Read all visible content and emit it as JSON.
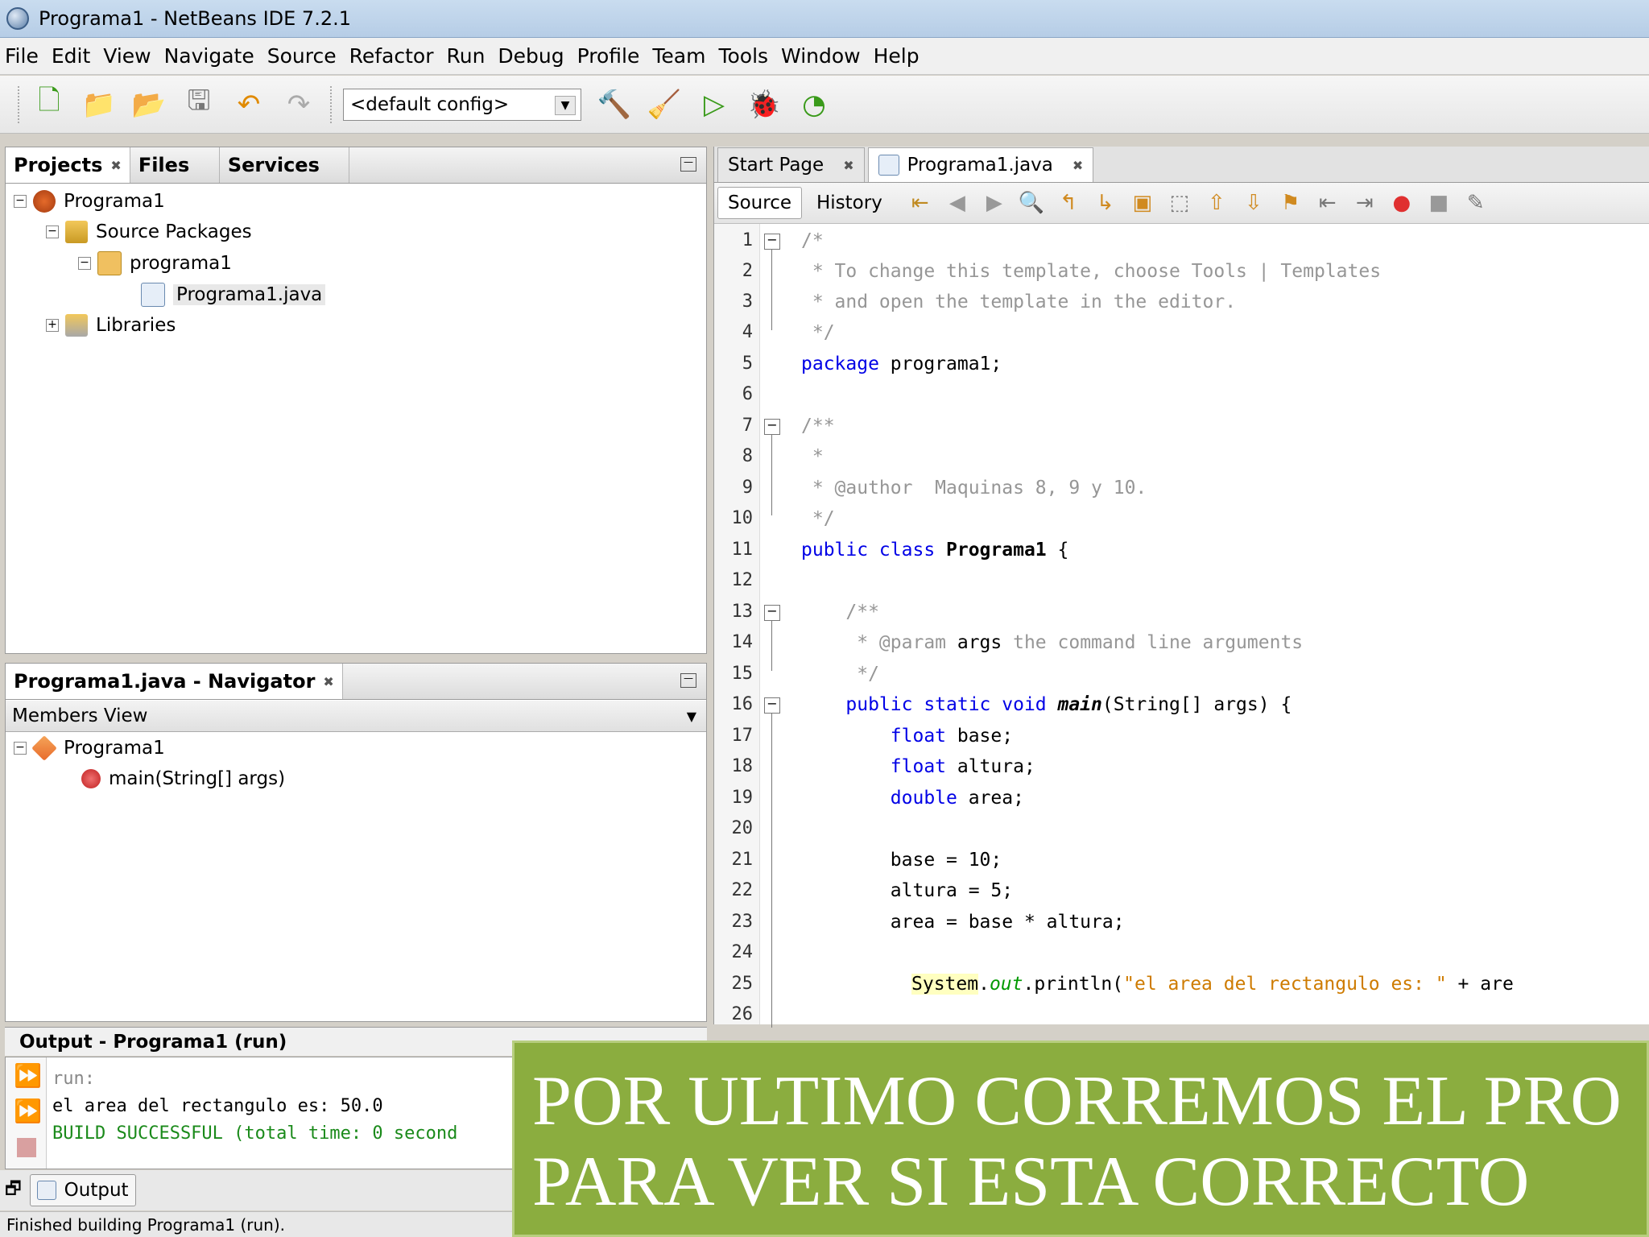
{
  "window": {
    "title": "Programa1 - NetBeans IDE 7.2.1"
  },
  "menu": [
    "File",
    "Edit",
    "View",
    "Navigate",
    "Source",
    "Refactor",
    "Run",
    "Debug",
    "Profile",
    "Team",
    "Tools",
    "Window",
    "Help"
  ],
  "toolbar": {
    "config_value": "<default config>"
  },
  "projects_panel": {
    "tabs": [
      "Projects",
      "Files",
      "Services"
    ],
    "tree": {
      "project": "Programa1",
      "source_packages": "Source Packages",
      "package": "programa1",
      "file": "Programa1.java",
      "libraries": "Libraries"
    }
  },
  "navigator": {
    "title": "Programa1.java - Navigator",
    "view": "Members View",
    "class": "Programa1",
    "member": "main(String[] args)"
  },
  "editor": {
    "tabs": [
      "Start Page",
      "Programa1.java"
    ],
    "modes": [
      "Source",
      "History"
    ],
    "line_numbers": [
      "1",
      "2",
      "3",
      "4",
      "5",
      "6",
      "7",
      "8",
      "9",
      "10",
      "11",
      "12",
      "13",
      "14",
      "15",
      "16",
      "17",
      "18",
      "19",
      "20",
      "21",
      "22",
      "23",
      "24",
      "25",
      "26"
    ],
    "code": {
      "l1": "/*",
      "l2": " * To change this template, choose Tools | Templates",
      "l3": " * and open the template in the editor.",
      "l4": " */",
      "l5_kw": "package",
      "l5_rest": " programa1;",
      "l7": "/**",
      "l8": " *",
      "l9": " * @author  Maquinas 8, 9 y 10.",
      "l10": " */",
      "l11_kw": "public class",
      "l11_name": " Programa1",
      "l11_rest": " {",
      "l13": "    /**",
      "l14_a": "     * @param",
      "l14_b": " args",
      "l14_c": " the command line arguments",
      "l15": "     */",
      "l16_kw": "    public static void",
      "l16_name": " main",
      "l16_rest": "(String[] args) {",
      "l17_kw": "        float",
      "l17_rest": " base;",
      "l18_kw": "        float",
      "l18_rest": " altura;",
      "l19_kw": "        double",
      "l19_rest": " area;",
      "l21": "        base = 10;",
      "l22": "        altura = 5;",
      "l23": "        area = base * altura;",
      "l25_sys": "System",
      "l25_dot": ".",
      "l25_out": "out",
      "l25_call": ".println(",
      "l25_str": "\"el area del rectangulo es: \"",
      "l25_rest": " + are"
    }
  },
  "output": {
    "title": "Output - Programa1 (run)",
    "lines": [
      "run:",
      "el area del rectangulo es: 50.0",
      "BUILD SUCCESSFUL (total time: 0 second"
    ],
    "tab": "Output"
  },
  "status": "Finished building Programa1 (run).",
  "caption": {
    "line1": "POR ULTIMO CORREMOS EL PRO",
    "line2": "PARA VER SI ESTA CORRECTO"
  },
  "colors": {
    "caption_bg": "#8bad3f",
    "keyword": "#0000e6",
    "comment": "#969696",
    "string": "#ce7b00"
  }
}
